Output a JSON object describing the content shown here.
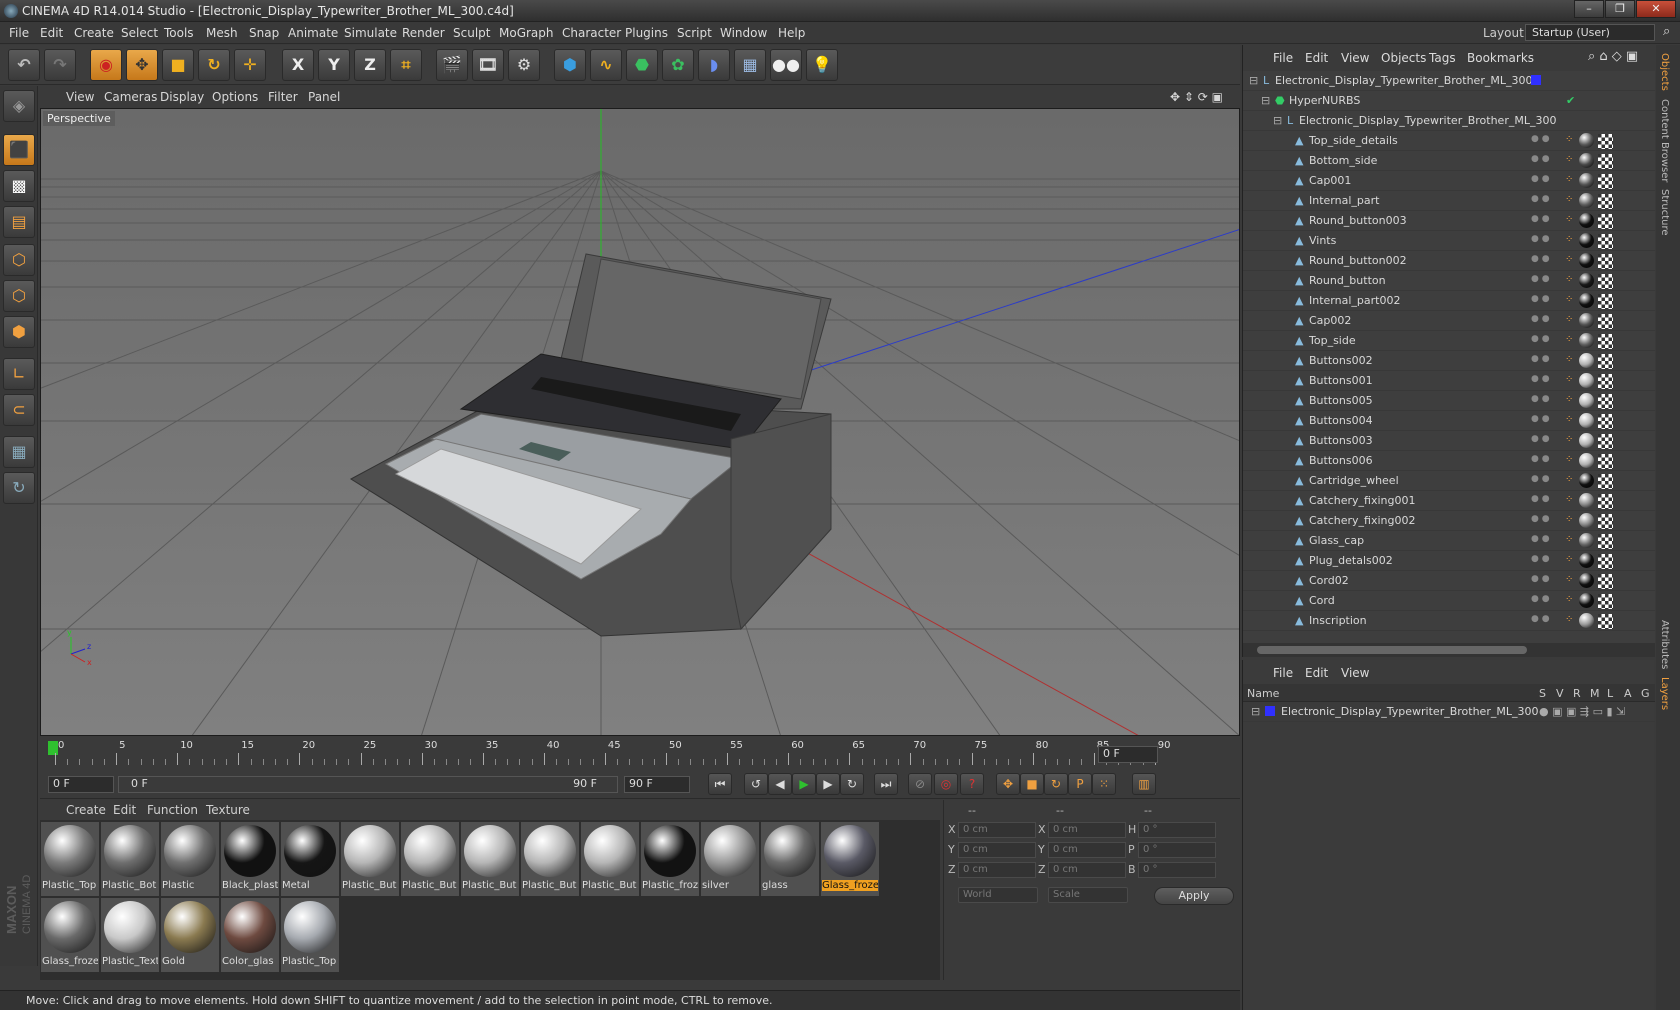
{
  "window": {
    "title": "CINEMA 4D R14.014 Studio - [Electronic_Display_Typewriter_Brother_ML_300.c4d]",
    "min": "–",
    "max": "❐",
    "close": "✕"
  },
  "menubar": {
    "items": [
      "File",
      "Edit",
      "Create",
      "Select",
      "Tools",
      "Mesh",
      "Snap",
      "Animate",
      "Simulate",
      "Render",
      "Sculpt",
      "MoGraph",
      "Character",
      "Plugins",
      "Script",
      "Window",
      "Help"
    ],
    "layout_label": "Layout:",
    "layout_value": "Startup (User)"
  },
  "toolbar": {
    "x_label": "X",
    "y_label": "Y",
    "z_label": "Z"
  },
  "viewport": {
    "menu": [
      "View",
      "Cameras",
      "Display",
      "Options",
      "Filter",
      "Panel"
    ],
    "label": "Perspective",
    "axis_x": "x",
    "axis_y": "y",
    "axis_z": "z"
  },
  "timeline": {
    "ticks": [
      "0",
      "5",
      "10",
      "15",
      "20",
      "25",
      "30",
      "35",
      "40",
      "45",
      "50",
      "55",
      "60",
      "65",
      "70",
      "75",
      "80",
      "85",
      "90"
    ],
    "current_frame_right": "0 F"
  },
  "transport": {
    "start_frame": "0 F",
    "range_start": "0 F",
    "range_end": "90 F",
    "end_frame": "90 F"
  },
  "materials": {
    "menu": [
      "Create",
      "Edit",
      "Function",
      "Texture"
    ],
    "items": [
      {
        "name": "Plastic_Top",
        "color": "#7b7b7b"
      },
      {
        "name": "Plastic_Bot",
        "color": "#6e6e6e"
      },
      {
        "name": "Plastic",
        "color": "#707070"
      },
      {
        "name": "Black_plast",
        "color": "#111111"
      },
      {
        "name": "Metal",
        "color": "#151515"
      },
      {
        "name": "Plastic_But",
        "color": "#b6b6b6"
      },
      {
        "name": "Plastic_But",
        "color": "#b6b6b6"
      },
      {
        "name": "Plastic_But",
        "color": "#b6b6b6"
      },
      {
        "name": "Plastic_But",
        "color": "#b6b6b6"
      },
      {
        "name": "Plastic_But",
        "color": "#b6b6b6"
      },
      {
        "name": "Plastic_froz",
        "color": "#121212"
      },
      {
        "name": "silver",
        "color": "#9a9a9a"
      },
      {
        "name": "glass",
        "color": "#6a6a6a"
      },
      {
        "name": "Glass_froze",
        "color": "#5a5a66",
        "selected": true
      },
      {
        "name": "Glass_froze",
        "color": "#6a6a6a"
      },
      {
        "name": "Plastic_Text",
        "color": "#c8c8c8"
      },
      {
        "name": "Gold",
        "color": "#8a7a50"
      },
      {
        "name": "Color_glas",
        "color": "#6e4a40"
      },
      {
        "name": "Plastic_Top",
        "color": "#a6aab0"
      }
    ]
  },
  "coords": {
    "header": [
      "--",
      "--",
      "--"
    ],
    "rows": [
      {
        "a": "X",
        "av": "0 cm",
        "b": "X",
        "bv": "0 cm",
        "c": "H",
        "cv": "0 °"
      },
      {
        "a": "Y",
        "av": "0 cm",
        "b": "Y",
        "bv": "0 cm",
        "c": "P",
        "cv": "0 °"
      },
      {
        "a": "Z",
        "av": "0 cm",
        "b": "Z",
        "bv": "0 cm",
        "c": "B",
        "cv": "0 °"
      }
    ],
    "world": "World",
    "scale": "Scale",
    "apply": "Apply"
  },
  "objects": {
    "menu": [
      "File",
      "Edit",
      "View",
      "Objects",
      "Tags",
      "Bookmarks"
    ],
    "root": "Electronic_Display_Typewriter_Brother_ML_300",
    "hypernurbs": "HyperNURBS",
    "group": "Electronic_Display_Typewriter_Brother_ML_300",
    "children": [
      {
        "name": "Top_side_details",
        "tag": "#5a5a5a"
      },
      {
        "name": "Bottom_side",
        "tag": "#4a4a4a"
      },
      {
        "name": "Cap001",
        "tag": "#555555"
      },
      {
        "name": "Internal_part",
        "tag": "#606060"
      },
      {
        "name": "Round_button003",
        "tag": "#111111"
      },
      {
        "name": "Vints",
        "tag": "#111111"
      },
      {
        "name": "Round_button002",
        "tag": "#111111"
      },
      {
        "name": "Round_button",
        "tag": "#1a1a1a"
      },
      {
        "name": "Internal_part002",
        "tag": "#111111"
      },
      {
        "name": "Cap002",
        "tag": "#555555"
      },
      {
        "name": "Top_side",
        "tag": "#606060"
      },
      {
        "name": "Buttons002",
        "tag": "#b0b0b0"
      },
      {
        "name": "Buttons001",
        "tag": "#b0b0b0"
      },
      {
        "name": "Buttons005",
        "tag": "#b0b0b0"
      },
      {
        "name": "Buttons004",
        "tag": "#b0b0b0"
      },
      {
        "name": "Buttons003",
        "tag": "#b0b0b0"
      },
      {
        "name": "Buttons006",
        "tag": "#b0b0b0"
      },
      {
        "name": "Cartridge_wheel",
        "tag": "#111111"
      },
      {
        "name": "Catchery_fixing001",
        "tag": "#888888"
      },
      {
        "name": "Catchery_fixing002",
        "tag": "#888888"
      },
      {
        "name": "Glass_cap",
        "tag": "#666666"
      },
      {
        "name": "Plug_detals002",
        "tag": "#111111"
      },
      {
        "name": "Cord02",
        "tag": "#111111"
      },
      {
        "name": "Cord",
        "tag": "#111111"
      },
      {
        "name": "Inscription",
        "tag": "#999999"
      }
    ]
  },
  "layers": {
    "menu": [
      "File",
      "Edit",
      "View"
    ],
    "headers": [
      "Name",
      "S",
      "V",
      "R",
      "M",
      "L",
      "A",
      "G"
    ],
    "row": "Electronic_Display_Typewriter_Brother_ML_300"
  },
  "sidetabs": [
    "Objects",
    "Content Browser",
    "Structure",
    "Attributes",
    "Layers"
  ],
  "status": "Move: Click and drag to move elements. Hold down SHIFT to quantize movement / add to the selection in point mode, CTRL to remove.",
  "branding": {
    "maxon": "MAXON",
    "cinema": "CINEMA 4D"
  }
}
